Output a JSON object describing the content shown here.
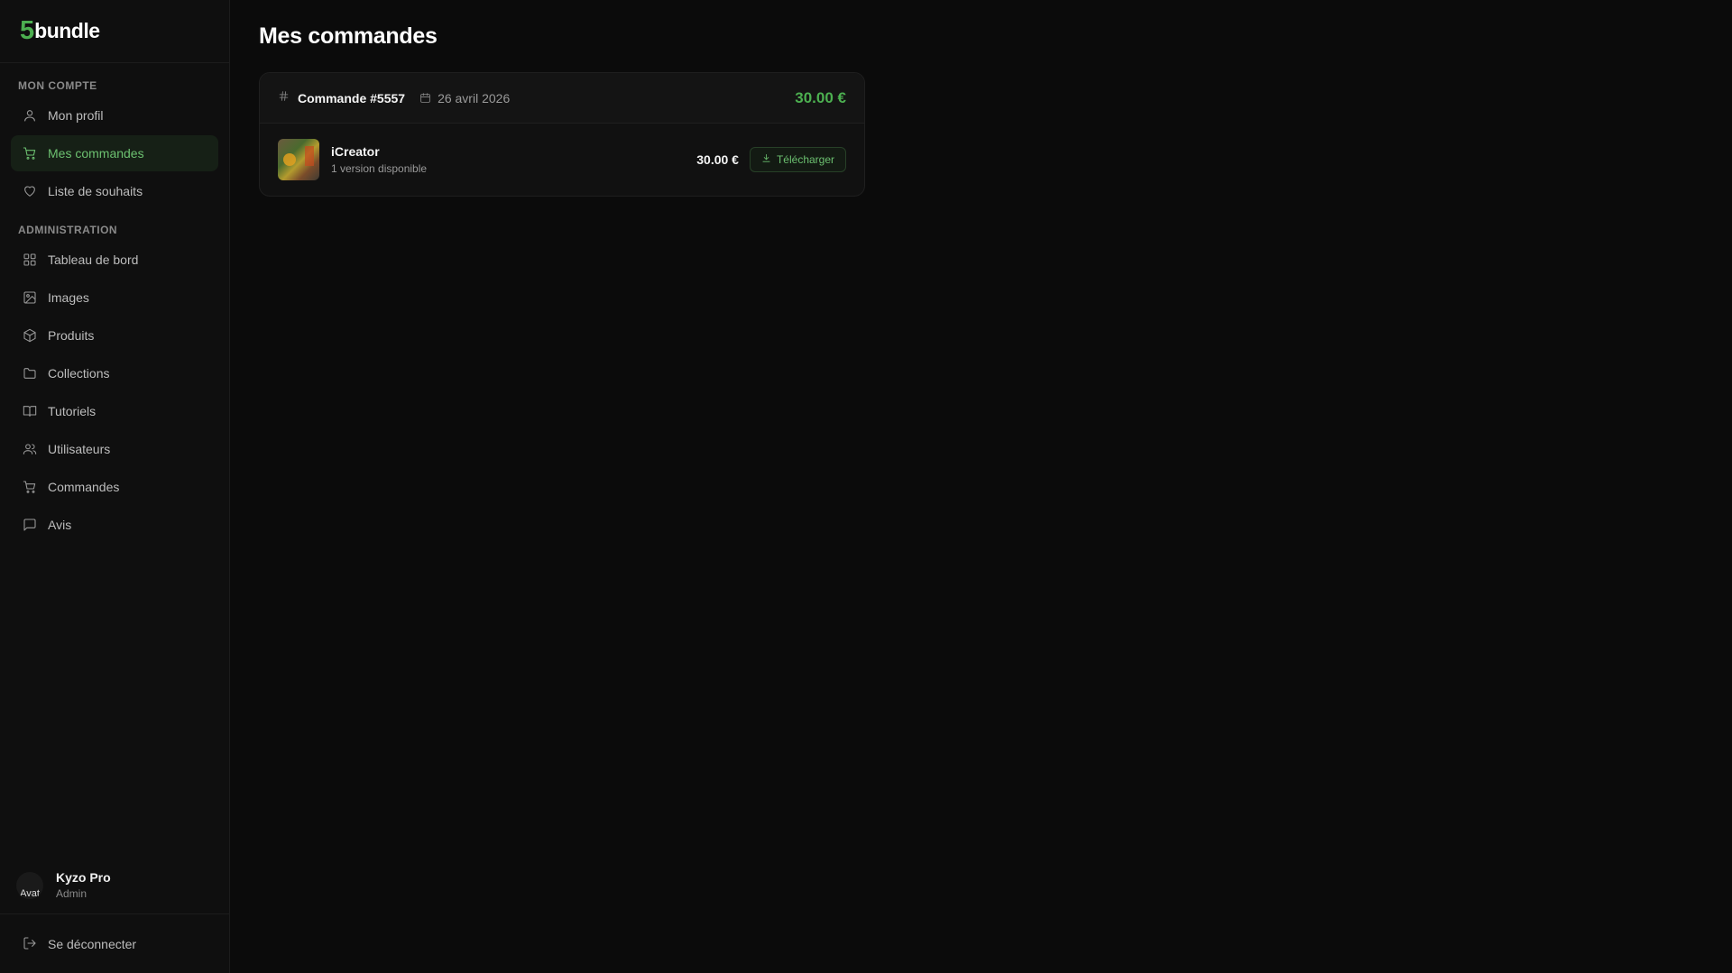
{
  "brand": {
    "mark": "5",
    "name": "bundle"
  },
  "sidebar": {
    "sections": [
      {
        "label": "MON COMPTE",
        "items": [
          {
            "label": "Mon profil",
            "icon": "user-icon",
            "active": false
          },
          {
            "label": "Mes commandes",
            "icon": "cart-icon",
            "active": true
          },
          {
            "label": "Liste de souhaits",
            "icon": "heart-icon",
            "active": false
          }
        ]
      },
      {
        "label": "ADMINISTRATION",
        "items": [
          {
            "label": "Tableau de bord",
            "icon": "dashboard-icon",
            "active": false
          },
          {
            "label": "Images",
            "icon": "image-icon",
            "active": false
          },
          {
            "label": "Produits",
            "icon": "package-icon",
            "active": false
          },
          {
            "label": "Collections",
            "icon": "folder-icon",
            "active": false
          },
          {
            "label": "Tutoriels",
            "icon": "book-icon",
            "active": false
          },
          {
            "label": "Utilisateurs",
            "icon": "users-icon",
            "active": false
          },
          {
            "label": "Commandes",
            "icon": "cart-icon",
            "active": false
          },
          {
            "label": "Avis",
            "icon": "message-icon",
            "active": false
          }
        ]
      }
    ]
  },
  "user": {
    "name": "Kyzo Pro",
    "role": "Admin",
    "avatar_alt": "Avat"
  },
  "logout": {
    "label": "Se déconnecter"
  },
  "main": {
    "title": "Mes commandes",
    "order": {
      "number": "Commande #5557",
      "date": "26 avril 2026",
      "total": "30.00 €",
      "items": [
        {
          "name": "iCreator",
          "subtitle": "1 version disponible",
          "price": "30.00 €",
          "download_label": "Télécharger"
        }
      ]
    }
  },
  "colors": {
    "accent": "#4caf50",
    "background": "#0b0b0b",
    "sidebar": "#0f0f0f"
  }
}
